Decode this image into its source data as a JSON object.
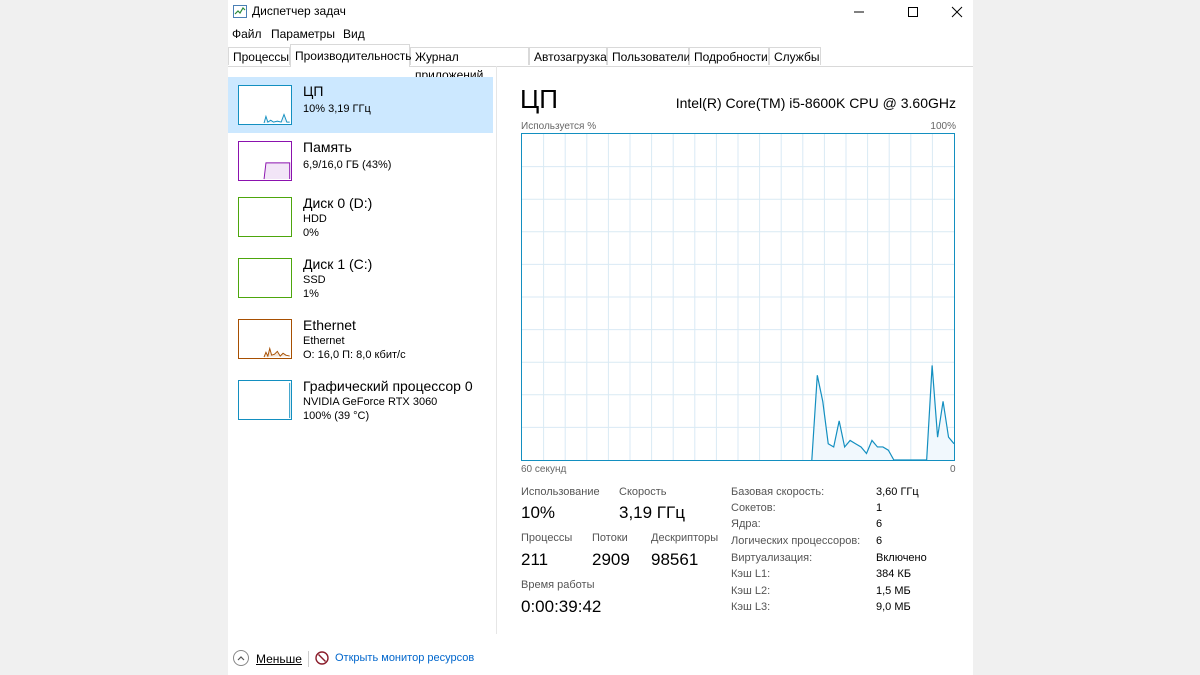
{
  "window": {
    "title": "Диспетчер задач"
  },
  "menu": [
    "Файл",
    "Параметры",
    "Вид"
  ],
  "tabs": [
    "Процессы",
    "Производительность",
    "Журнал приложений",
    "Автозагрузка",
    "Пользователи",
    "Подробности",
    "Службы"
  ],
  "active_tab": "Производительность",
  "sidebar": {
    "items": [
      {
        "title": "ЦП",
        "lines": [
          "10% 3,19 ГГц"
        ],
        "color": "#138fc0",
        "active": true
      },
      {
        "title": "Память",
        "lines": [
          "6,9/16,0 ГБ (43%)"
        ],
        "color": "#8b12ae",
        "active": false
      },
      {
        "title": "Диск 0 (D:)",
        "lines": [
          "HDD",
          "0%"
        ],
        "color": "#4da60c",
        "active": false
      },
      {
        "title": "Диск 1 (C:)",
        "lines": [
          "SSD",
          "1%"
        ],
        "color": "#4da60c",
        "active": false
      },
      {
        "title": "Ethernet",
        "lines": [
          "Ethernet",
          "О: 16,0 П: 8,0 кбит/с"
        ],
        "color": "#a74f01",
        "active": false
      },
      {
        "title": "Графический процессор 0",
        "lines": [
          "NVIDIA GeForce RTX 3060",
          "100% (39 °C)"
        ],
        "color": "#138fc0",
        "active": false
      }
    ]
  },
  "main": {
    "title": "ЦП",
    "model": "Intel(R) Core(TM) i5-8600K CPU @ 3.60GHz",
    "graph_top_left": "Используется %",
    "graph_top_right": "100%",
    "graph_bottom_left": "60 секунд",
    "graph_bottom_right": "0"
  },
  "stats": {
    "usage_label": "Использование",
    "usage_value": "10%",
    "speed_label": "Скорость",
    "speed_value": "3,19 ГГц",
    "processes_label": "Процессы",
    "processes_value": "211",
    "threads_label": "Потоки",
    "threads_value": "2909",
    "handles_label": "Дескрипторы",
    "handles_value": "98561",
    "uptime_label": "Время работы",
    "uptime_value": "0:00:39:42"
  },
  "specs": [
    {
      "label": "Базовая скорость:",
      "value": "3,60 ГГц"
    },
    {
      "label": "Сокетов:",
      "value": "1"
    },
    {
      "label": "Ядра:",
      "value": "6"
    },
    {
      "label": "Логических процессоров:",
      "value": "6"
    },
    {
      "label": "Виртуализация:",
      "value": "Включено"
    },
    {
      "label": "Кэш L1:",
      "value": "384 КБ"
    },
    {
      "label": "Кэш L2:",
      "value": "1,5 МБ"
    },
    {
      "label": "Кэш L3:",
      "value": "9,0 МБ"
    }
  ],
  "footer": {
    "fewer_label": "Меньше",
    "monitor_link": "Открыть монитор ресурсов"
  },
  "cpu_history": [
    0,
    0,
    0,
    0,
    0,
    0,
    0,
    0,
    0,
    0,
    0,
    0,
    0,
    0,
    0,
    0,
    0,
    0,
    0,
    0,
    0,
    0,
    0,
    0,
    0,
    0,
    0,
    0,
    0,
    0,
    0,
    0,
    0,
    0,
    0,
    0,
    0,
    0,
    0,
    0,
    0,
    0,
    0,
    0,
    0,
    0,
    0,
    0,
    0,
    0,
    0,
    0,
    0,
    0,
    26,
    18,
    5,
    4,
    12,
    4,
    6,
    5,
    4,
    2,
    6,
    4,
    4,
    3,
    0,
    0,
    0,
    0,
    0,
    0,
    0,
    29,
    7,
    18,
    7,
    5
  ]
}
